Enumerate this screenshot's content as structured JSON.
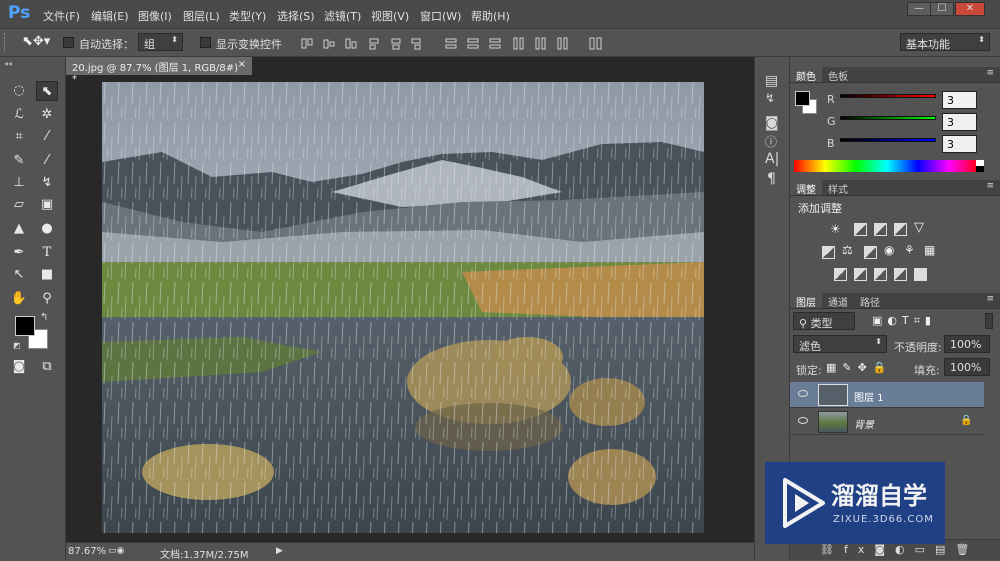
{
  "app": {
    "logo": "Ps"
  },
  "menu": [
    "文件(F)",
    "编辑(E)",
    "图像(I)",
    "图层(L)",
    "类型(Y)",
    "选择(S)",
    "滤镜(T)",
    "视图(V)",
    "窗口(W)",
    "帮助(H)"
  ],
  "window_buttons": [
    "—",
    "☐",
    "✕"
  ],
  "options": {
    "auto_select_label": "自动选择：",
    "auto_select_value": "组",
    "show_transform_label": "显示变换控件",
    "workspace": "基本功能"
  },
  "document": {
    "tab_title": "20.jpg @ 87.7% (图层 1, RGB/8#) *",
    "tab_close": "×",
    "zoom": "87.67%",
    "doc_info": "文档:1.37M/2.75M"
  },
  "color_panel": {
    "tabs": [
      "颜色",
      "色板"
    ],
    "channels": [
      {
        "label": "R",
        "value": "3",
        "color": "#ff0000"
      },
      {
        "label": "G",
        "value": "3",
        "color": "#00ff00"
      },
      {
        "label": "B",
        "value": "3",
        "color": "#0000ff"
      }
    ]
  },
  "adjust_panel": {
    "tabs": [
      "调整",
      "样式"
    ],
    "title": "添加调整"
  },
  "layers_panel": {
    "tabs": [
      "图层",
      "通道",
      "路径"
    ],
    "filter_kind": "类型",
    "blend_mode": "滤色",
    "opacity_label": "不透明度:",
    "opacity_value": "100%",
    "lock_label": "锁定:",
    "fill_label": "填充:",
    "fill_value": "100%",
    "layers": [
      {
        "name": "图层 1",
        "selected": true
      },
      {
        "name": "背景",
        "selected": false,
        "italic": true
      }
    ]
  },
  "watermark": {
    "brand": "溜溜自学",
    "url": "ZIXUE.3D66.COM"
  }
}
